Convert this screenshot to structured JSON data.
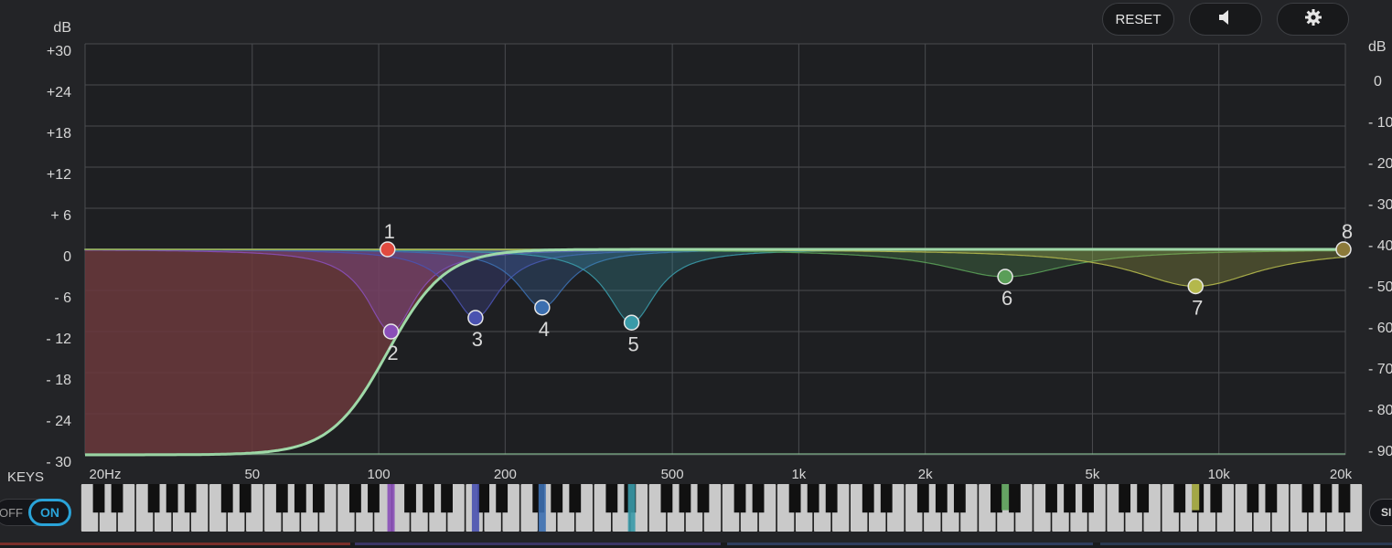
{
  "toolbar": {
    "reset_label": "RESET",
    "speaker_icon": "speaker-icon",
    "settings_icon": "gear-icon"
  },
  "graph": {
    "left_unit": "dB",
    "right_unit": "dB",
    "left_ticks": [
      "+30",
      "+24",
      "+18",
      "+12",
      "+ 6",
      "0",
      "- 6",
      "- 12",
      "- 18",
      "- 24",
      "- 30"
    ],
    "right_ticks": [
      "0",
      "- 10",
      "- 20",
      "- 30",
      "- 40",
      "- 50",
      "- 60",
      "- 70",
      "- 80",
      "- 90"
    ],
    "freq_labels": [
      "20Hz",
      "50",
      "100",
      "200",
      "500",
      "1k",
      "2k",
      "5k",
      "10k",
      "20k"
    ],
    "colors": {
      "background": "#1e1f22",
      "grid": "#4a4b4f",
      "composite_curve": "#9fd9a8",
      "low_cut_fill": "#6b3a3c"
    },
    "bands": [
      {
        "number": "1",
        "type": "low-cut",
        "freq_hz": 105,
        "gain_db": 0,
        "color": "#e04a3f"
      },
      {
        "number": "2",
        "type": "notch",
        "freq_hz": 107,
        "gain_db": -12,
        "color": "#8a4fb8"
      },
      {
        "number": "3",
        "type": "notch",
        "freq_hz": 170,
        "gain_db": -10,
        "color": "#4a52b0"
      },
      {
        "number": "4",
        "type": "notch",
        "freq_hz": 245,
        "gain_db": -8.5,
        "color": "#3c6fb0"
      },
      {
        "number": "5",
        "type": "notch",
        "freq_hz": 400,
        "gain_db": -10.7,
        "color": "#3a9aa8"
      },
      {
        "number": "6",
        "type": "bell",
        "freq_hz": 3100,
        "gain_db": -4,
        "color": "#5a9e58"
      },
      {
        "number": "7",
        "type": "bell",
        "freq_hz": 8800,
        "gain_db": -5.4,
        "color": "#b4b84c"
      },
      {
        "number": "8",
        "type": "high-shelf",
        "freq_hz": 20000,
        "gain_db": 0,
        "color": "#8c7a3a"
      }
    ]
  },
  "keys": {
    "label": "KEYS",
    "off_label": "OFF",
    "on_label": "ON"
  },
  "right_edge_button_label": "SI"
}
